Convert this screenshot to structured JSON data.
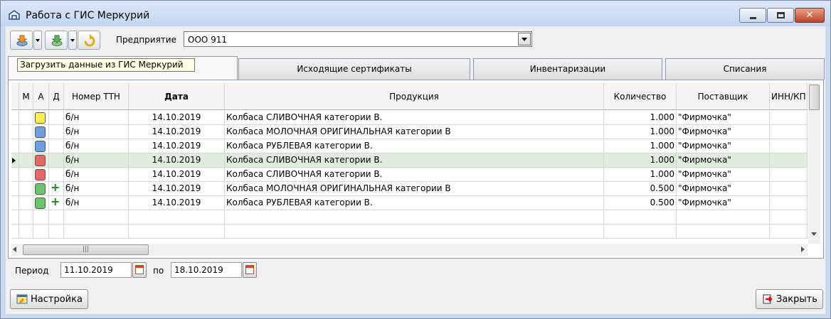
{
  "window": {
    "title": "Работа с ГИС Меркурий",
    "min_icon": "minimize-icon",
    "max_icon": "maximize-icon",
    "close_icon": "close-icon"
  },
  "toolbar": {
    "buttons": [
      {
        "icon": "download-icon",
        "has_dropdown": true
      },
      {
        "icon": "upload-icon",
        "has_dropdown": true
      },
      {
        "icon": "refresh-icon",
        "has_dropdown": false
      }
    ],
    "enterprise_label": "Предприятие",
    "enterprise_value": "ООО 911"
  },
  "tooltip": "Загрузить данные из ГИС Меркурий",
  "tabs": [
    {
      "label": "",
      "active": true
    },
    {
      "label": "Исходящие сертификаты",
      "active": false
    },
    {
      "label": "Инвентаризации",
      "active": false
    },
    {
      "label": "Списания",
      "active": false
    }
  ],
  "grid": {
    "columns": [
      "М",
      "А",
      "Д",
      "Номер ТТН",
      "Дата",
      "Продукция",
      "Количество",
      "Поставщик",
      "ИНН/КП"
    ],
    "rows": [
      {
        "status": "#ffef55",
        "plus": "",
        "ttn": "б/н",
        "date": "14.10.2019",
        "product": "Колбаса  СЛИВОЧНАЯ категории В.",
        "qty": "1.000",
        "supplier": "\"Фирмочка\"",
        "selected": false
      },
      {
        "status": "#6f9ee0",
        "plus": "",
        "ttn": "б/н",
        "date": "14.10.2019",
        "product": "Колбаса МОЛОЧНАЯ ОРИГИНАЛЬНАЯ категории В",
        "qty": "1.000",
        "supplier": "\"Фирмочка\"",
        "selected": false
      },
      {
        "status": "#6f9ee0",
        "plus": "",
        "ttn": "б/н",
        "date": "14.10.2019",
        "product": "Колбаса РУБЛЕВАЯ категории В.",
        "qty": "1.000",
        "supplier": "\"Фирмочка\"",
        "selected": false
      },
      {
        "status": "#e56767",
        "plus": "",
        "ttn": "б/н",
        "date": "14.10.2019",
        "product": "Колбаса  СЛИВОЧНАЯ категории В.",
        "qty": "1.000",
        "supplier": "\"Фирмочка\"",
        "selected": true
      },
      {
        "status": "#e56767",
        "plus": "",
        "ttn": "б/н",
        "date": "14.10.2019",
        "product": "Колбаса  СЛИВОЧНАЯ категории В.",
        "qty": "1.000",
        "supplier": "\"Фирмочка\"",
        "selected": false
      },
      {
        "status": "#6cc36c",
        "plus": "+",
        "ttn": "б/н",
        "date": "14.10.2019",
        "product": "Колбаса МОЛОЧНАЯ ОРИГИНАЛЬНАЯ категории В",
        "qty": "0.500",
        "supplier": "\"Фирмочка\"",
        "selected": false
      },
      {
        "status": "#6cc36c",
        "plus": "+",
        "ttn": "б/н",
        "date": "14.10.2019",
        "product": "Колбаса РУБЛЕВАЯ категории В.",
        "qty": "0.500",
        "supplier": "\"Фирмочка\"",
        "selected": false
      }
    ],
    "empty_rows": 2
  },
  "period": {
    "label": "Период",
    "from": "11.10.2019",
    "to_label": "по",
    "to": "18.10.2019"
  },
  "footer": {
    "settings_label": "Настройка",
    "close_label": "Закрыть"
  }
}
